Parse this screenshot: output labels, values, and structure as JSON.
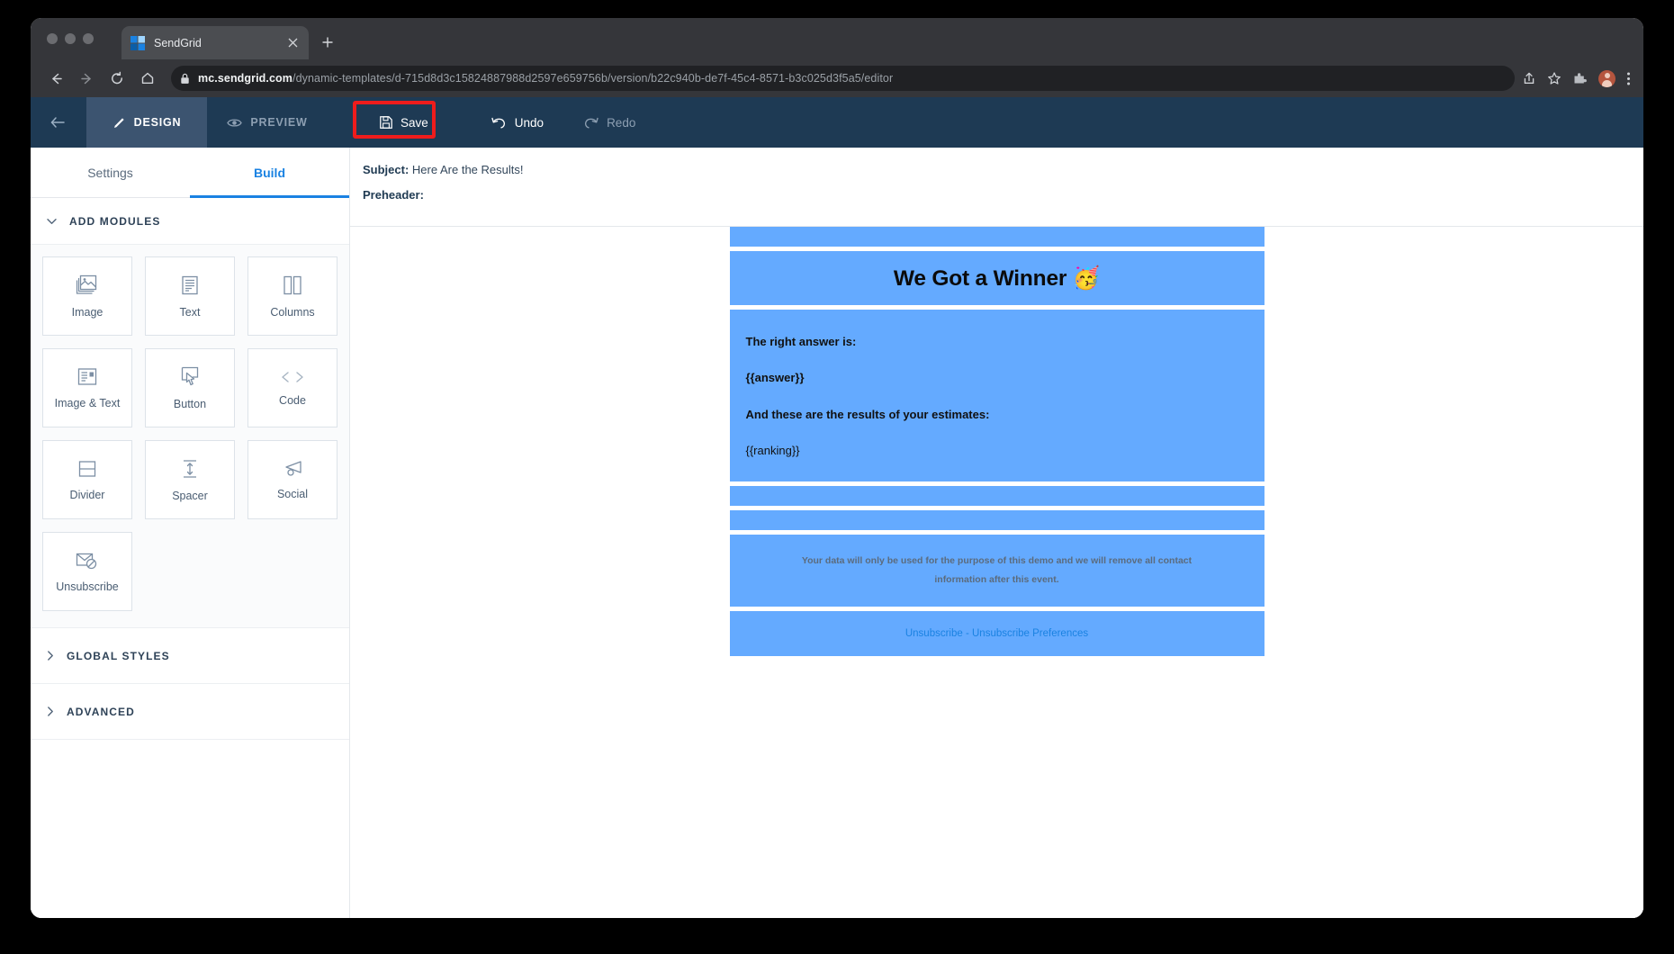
{
  "browser": {
    "tab": {
      "title": "SendGrid",
      "favicon_icon": "sendgrid-favicon",
      "close_icon": "close-icon"
    },
    "newtab_icon": "plus-icon",
    "nav": {
      "back_icon": "arrow-left-icon",
      "forward_icon": "arrow-right-icon",
      "reload_icon": "reload-icon",
      "home_icon": "home-icon"
    },
    "url": {
      "lock_icon": "lock-icon",
      "domain": "mc.sendgrid.com",
      "path": "/dynamic-templates/d-715d8d3c15824887988d2597e659756b/version/b22c940b-de7f-45c4-8571-b3c025d3f5a5/editor"
    },
    "omni_icons": [
      "share-icon",
      "star-icon",
      "extensions-icon",
      "profile-avatar",
      "menu-icon"
    ]
  },
  "toolbar": {
    "back_icon": "arrow-left-icon",
    "design_label": "DESIGN",
    "design_icon": "pencil-icon",
    "preview_label": "PREVIEW",
    "preview_icon": "eye-icon",
    "save_label": "Save",
    "save_icon": "save-disk-icon",
    "undo_label": "Undo",
    "undo_icon": "undo-arrow-icon",
    "redo_label": "Redo",
    "redo_icon": "redo-arrow-icon",
    "highlight_color": "#ef1c1c",
    "background_color": "#1e3a54"
  },
  "sidebar": {
    "tabs": [
      {
        "label": "Settings",
        "active": false
      },
      {
        "label": "Build",
        "active": true
      }
    ],
    "sections": [
      {
        "title": "ADD MODULES",
        "expanded": true,
        "chevron_icon": "chevron-down-icon"
      },
      {
        "title": "GLOBAL STYLES",
        "expanded": false,
        "chevron_icon": "chevron-right-icon"
      },
      {
        "title": "ADVANCED",
        "expanded": false,
        "chevron_icon": "chevron-right-icon"
      }
    ],
    "modules": [
      {
        "label": "Image",
        "icon": "image-icon"
      },
      {
        "label": "Text",
        "icon": "text-lines-icon"
      },
      {
        "label": "Columns",
        "icon": "columns-icon"
      },
      {
        "label": "Image & Text",
        "icon": "image-text-icon"
      },
      {
        "label": "Button",
        "icon": "button-cursor-icon"
      },
      {
        "label": "Code",
        "icon": "code-brackets-icon"
      },
      {
        "label": "Divider",
        "icon": "divider-icon"
      },
      {
        "label": "Spacer",
        "icon": "spacer-arrows-icon"
      },
      {
        "label": "Social",
        "icon": "social-megaphone-icon"
      },
      {
        "label": "Unsubscribe",
        "icon": "unsubscribe-envelope-icon"
      }
    ],
    "accent_color": "#1a82e2"
  },
  "canvas": {
    "subject_label": "Subject:",
    "subject_value": "Here Are the Results!",
    "preheader_label": "Preheader:",
    "preheader_value": ""
  },
  "email": {
    "block_color": "#64aaff",
    "title": "We Got a Winner 🥳",
    "paragraphs": [
      {
        "text": "The right answer is:",
        "bold": true
      },
      {
        "text": "{{answer}}",
        "bold": true
      },
      {
        "text": "And these are the results of your estimates:",
        "bold": true
      },
      {
        "text": "{{ranking}}",
        "bold": false
      }
    ],
    "disclaimer": "Your data will only be used for the purpose of this demo and we will remove all contact information after this event.",
    "unsubscribe_text": "Unsubscribe - Unsubscribe Preferences"
  }
}
